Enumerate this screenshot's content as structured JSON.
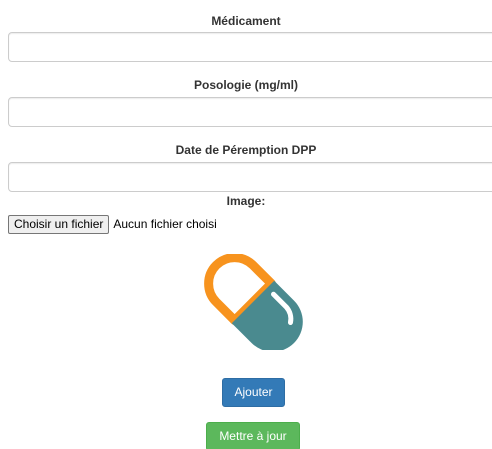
{
  "form": {
    "medicament_label": "Médicament",
    "medicament_value": "",
    "posologie_label": "Posologie (mg/ml)",
    "posologie_value": "",
    "dpp_label": "Date de Péremption DPP",
    "dpp_value": "",
    "image_label": "Image:",
    "file_button_label": "Choisir un fichier",
    "file_status": "Aucun fichier choisi"
  },
  "image": {
    "icon": "pill-capsule-icon",
    "colors": {
      "orange": "#f7931e",
      "teal": "#4a8a8f",
      "white": "#ffffff"
    }
  },
  "actions": {
    "add_label": "Ajouter",
    "update_label": "Mettre à jour"
  },
  "colors": {
    "primary": "#337ab7",
    "success": "#5cb85c",
    "text": "#333333",
    "border": "#cccccc"
  }
}
